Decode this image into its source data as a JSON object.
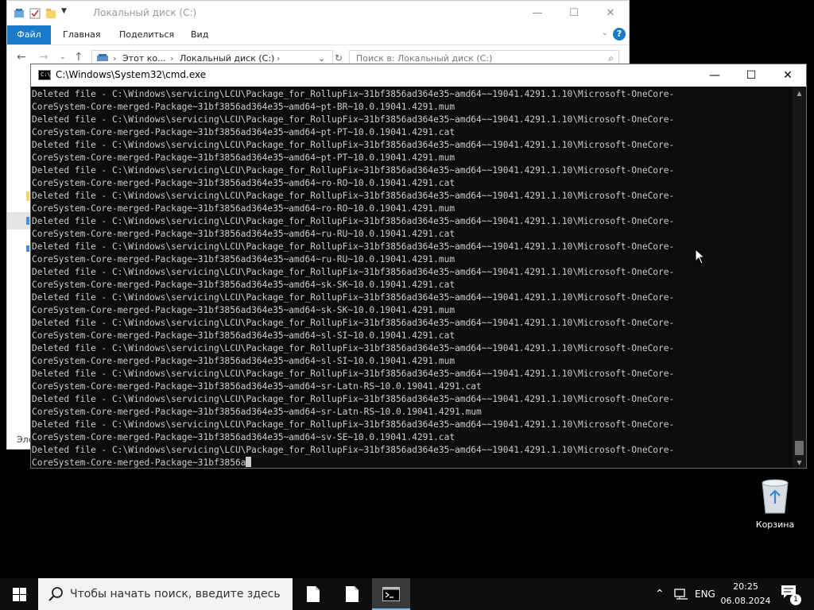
{
  "explorer": {
    "title": "Локальный диск (C:)",
    "ribbon": {
      "file_tab": "Файл",
      "tabs": [
        "Главная",
        "Поделиться",
        "Вид"
      ]
    },
    "address": {
      "segments": [
        "Этот ко...",
        "Локальный диск (C:)"
      ]
    },
    "search": {
      "placeholder": "Поиск в: Локальный диск (C:)"
    },
    "status_fragment": "Эле"
  },
  "cmd": {
    "title": "C:\\Windows\\System32\\cmd.exe",
    "lines": [
      "Deleted file - C:\\Windows\\servicing\\LCU\\Package_for_RollupFix~31bf3856ad364e35~amd64~~19041.4291.1.10\\Microsoft-OneCore-",
      "CoreSystem-Core-merged-Package~31bf3856ad364e35~amd64~pt-BR~10.0.19041.4291.mum",
      "Deleted file - C:\\Windows\\servicing\\LCU\\Package_for_RollupFix~31bf3856ad364e35~amd64~~19041.4291.1.10\\Microsoft-OneCore-",
      "CoreSystem-Core-merged-Package~31bf3856ad364e35~amd64~pt-PT~10.0.19041.4291.cat",
      "Deleted file - C:\\Windows\\servicing\\LCU\\Package_for_RollupFix~31bf3856ad364e35~amd64~~19041.4291.1.10\\Microsoft-OneCore-",
      "CoreSystem-Core-merged-Package~31bf3856ad364e35~amd64~pt-PT~10.0.19041.4291.mum",
      "Deleted file - C:\\Windows\\servicing\\LCU\\Package_for_RollupFix~31bf3856ad364e35~amd64~~19041.4291.1.10\\Microsoft-OneCore-",
      "CoreSystem-Core-merged-Package~31bf3856ad364e35~amd64~ro-RO~10.0.19041.4291.cat",
      "Deleted file - C:\\Windows\\servicing\\LCU\\Package_for_RollupFix~31bf3856ad364e35~amd64~~19041.4291.1.10\\Microsoft-OneCore-",
      "CoreSystem-Core-merged-Package~31bf3856ad364e35~amd64~ro-RO~10.0.19041.4291.mum",
      "Deleted file - C:\\Windows\\servicing\\LCU\\Package_for_RollupFix~31bf3856ad364e35~amd64~~19041.4291.1.10\\Microsoft-OneCore-",
      "CoreSystem-Core-merged-Package~31bf3856ad364e35~amd64~ru-RU~10.0.19041.4291.cat",
      "Deleted file - C:\\Windows\\servicing\\LCU\\Package_for_RollupFix~31bf3856ad364e35~amd64~~19041.4291.1.10\\Microsoft-OneCore-",
      "CoreSystem-Core-merged-Package~31bf3856ad364e35~amd64~ru-RU~10.0.19041.4291.mum",
      "Deleted file - C:\\Windows\\servicing\\LCU\\Package_for_RollupFix~31bf3856ad364e35~amd64~~19041.4291.1.10\\Microsoft-OneCore-",
      "CoreSystem-Core-merged-Package~31bf3856ad364e35~amd64~sk-SK~10.0.19041.4291.cat",
      "Deleted file - C:\\Windows\\servicing\\LCU\\Package_for_RollupFix~31bf3856ad364e35~amd64~~19041.4291.1.10\\Microsoft-OneCore-",
      "CoreSystem-Core-merged-Package~31bf3856ad364e35~amd64~sk-SK~10.0.19041.4291.mum",
      "Deleted file - C:\\Windows\\servicing\\LCU\\Package_for_RollupFix~31bf3856ad364e35~amd64~~19041.4291.1.10\\Microsoft-OneCore-",
      "CoreSystem-Core-merged-Package~31bf3856ad364e35~amd64~sl-SI~10.0.19041.4291.cat",
      "Deleted file - C:\\Windows\\servicing\\LCU\\Package_for_RollupFix~31bf3856ad364e35~amd64~~19041.4291.1.10\\Microsoft-OneCore-",
      "CoreSystem-Core-merged-Package~31bf3856ad364e35~amd64~sl-SI~10.0.19041.4291.mum",
      "Deleted file - C:\\Windows\\servicing\\LCU\\Package_for_RollupFix~31bf3856ad364e35~amd64~~19041.4291.1.10\\Microsoft-OneCore-",
      "CoreSystem-Core-merged-Package~31bf3856ad364e35~amd64~sr-Latn-RS~10.0.19041.4291.cat",
      "Deleted file - C:\\Windows\\servicing\\LCU\\Package_for_RollupFix~31bf3856ad364e35~amd64~~19041.4291.1.10\\Microsoft-OneCore-",
      "CoreSystem-Core-merged-Package~31bf3856ad364e35~amd64~sr-Latn-RS~10.0.19041.4291.mum",
      "Deleted file - C:\\Windows\\servicing\\LCU\\Package_for_RollupFix~31bf3856ad364e35~amd64~~19041.4291.1.10\\Microsoft-OneCore-",
      "CoreSystem-Core-merged-Package~31bf3856ad364e35~amd64~sv-SE~10.0.19041.4291.cat",
      "Deleted file - C:\\Windows\\servicing\\LCU\\Package_for_RollupFix~31bf3856ad364e35~amd64~~19041.4291.1.10\\Microsoft-OneCore-"
    ],
    "prompt_line": "CoreSystem-Core-merged-Package~31bf3856a"
  },
  "desktop": {
    "recycle_bin_label": "Корзина"
  },
  "taskbar": {
    "search_placeholder": "Чтобы начать поиск, введите здесь",
    "language": "ENG",
    "time": "20:25",
    "date": "06.08.2024",
    "notification_count": "1"
  },
  "colors": {
    "accent": "#1979ca",
    "console_bg": "#0c0c0c",
    "console_text": "#cccccc",
    "taskbar_bg": "#0d0d0d"
  }
}
